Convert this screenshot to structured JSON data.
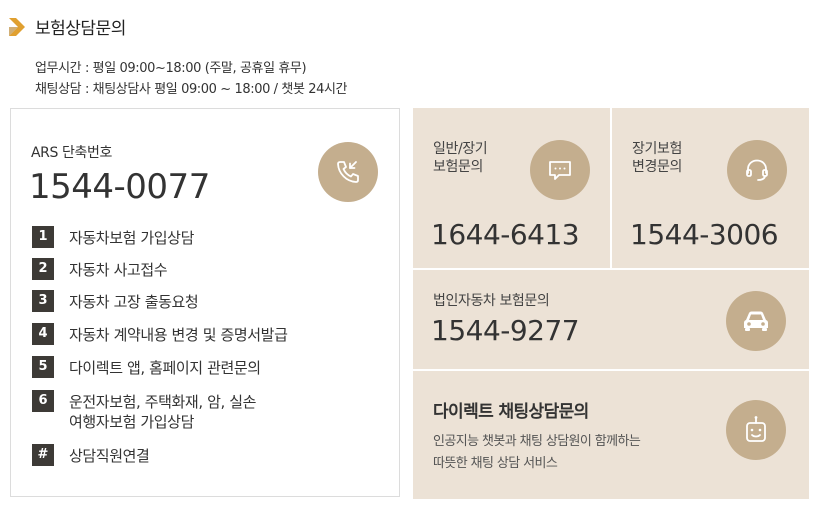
{
  "header": {
    "title": "보험상담문의",
    "hours_line": "업무시간 : 평일 09:00~18:00 (주말, 공휴일 휴무)",
    "chat_line": "채팅상담 : 채팅상담사 평일 09:00 ~ 18:00 / 챗봇 24시간"
  },
  "ars": {
    "label": "ARS 단축번호",
    "number": "1544-0077",
    "menu": [
      {
        "key": "1",
        "text": "자동차보험 가입상담"
      },
      {
        "key": "2",
        "text": "자동차 사고접수"
      },
      {
        "key": "3",
        "text": "자동차 고장 출동요청"
      },
      {
        "key": "4",
        "text": "자동차 계약내용 변경 및 증명서발급"
      },
      {
        "key": "5",
        "text": "다이렉트 앱, 홈페이지 관련문의"
      },
      {
        "key": "6",
        "text": "운전자보험, 주택화재, 암, 실손",
        "text2": "여행자보험 가입상담"
      },
      {
        "key": "#",
        "text": "상담직원연결"
      }
    ]
  },
  "general": {
    "label1": "일반/장기",
    "label2": "보험문의",
    "number": "1644-6413"
  },
  "longterm": {
    "label1": "장기보험",
    "label2": "변경문의",
    "number": "1544-3006"
  },
  "corporate": {
    "label": "법인자동차 보험문의",
    "number": "1544-9277"
  },
  "chat": {
    "title": "다이렉트 채팅상담문의",
    "desc1": "인공지능 챗봇과 채팅 상담원이 함께하는",
    "desc2": "따뜻한 채팅 상담 서비스"
  },
  "colors": {
    "accent": "#c4ae8e",
    "panel": "#ece2d6",
    "badge": "#3d3a36",
    "arrow": "#e0a030"
  },
  "icons": [
    "chevron-right-icon",
    "phone-call-icon",
    "chat-bubble-icon",
    "headset-icon",
    "car-icon",
    "robot-icon"
  ]
}
